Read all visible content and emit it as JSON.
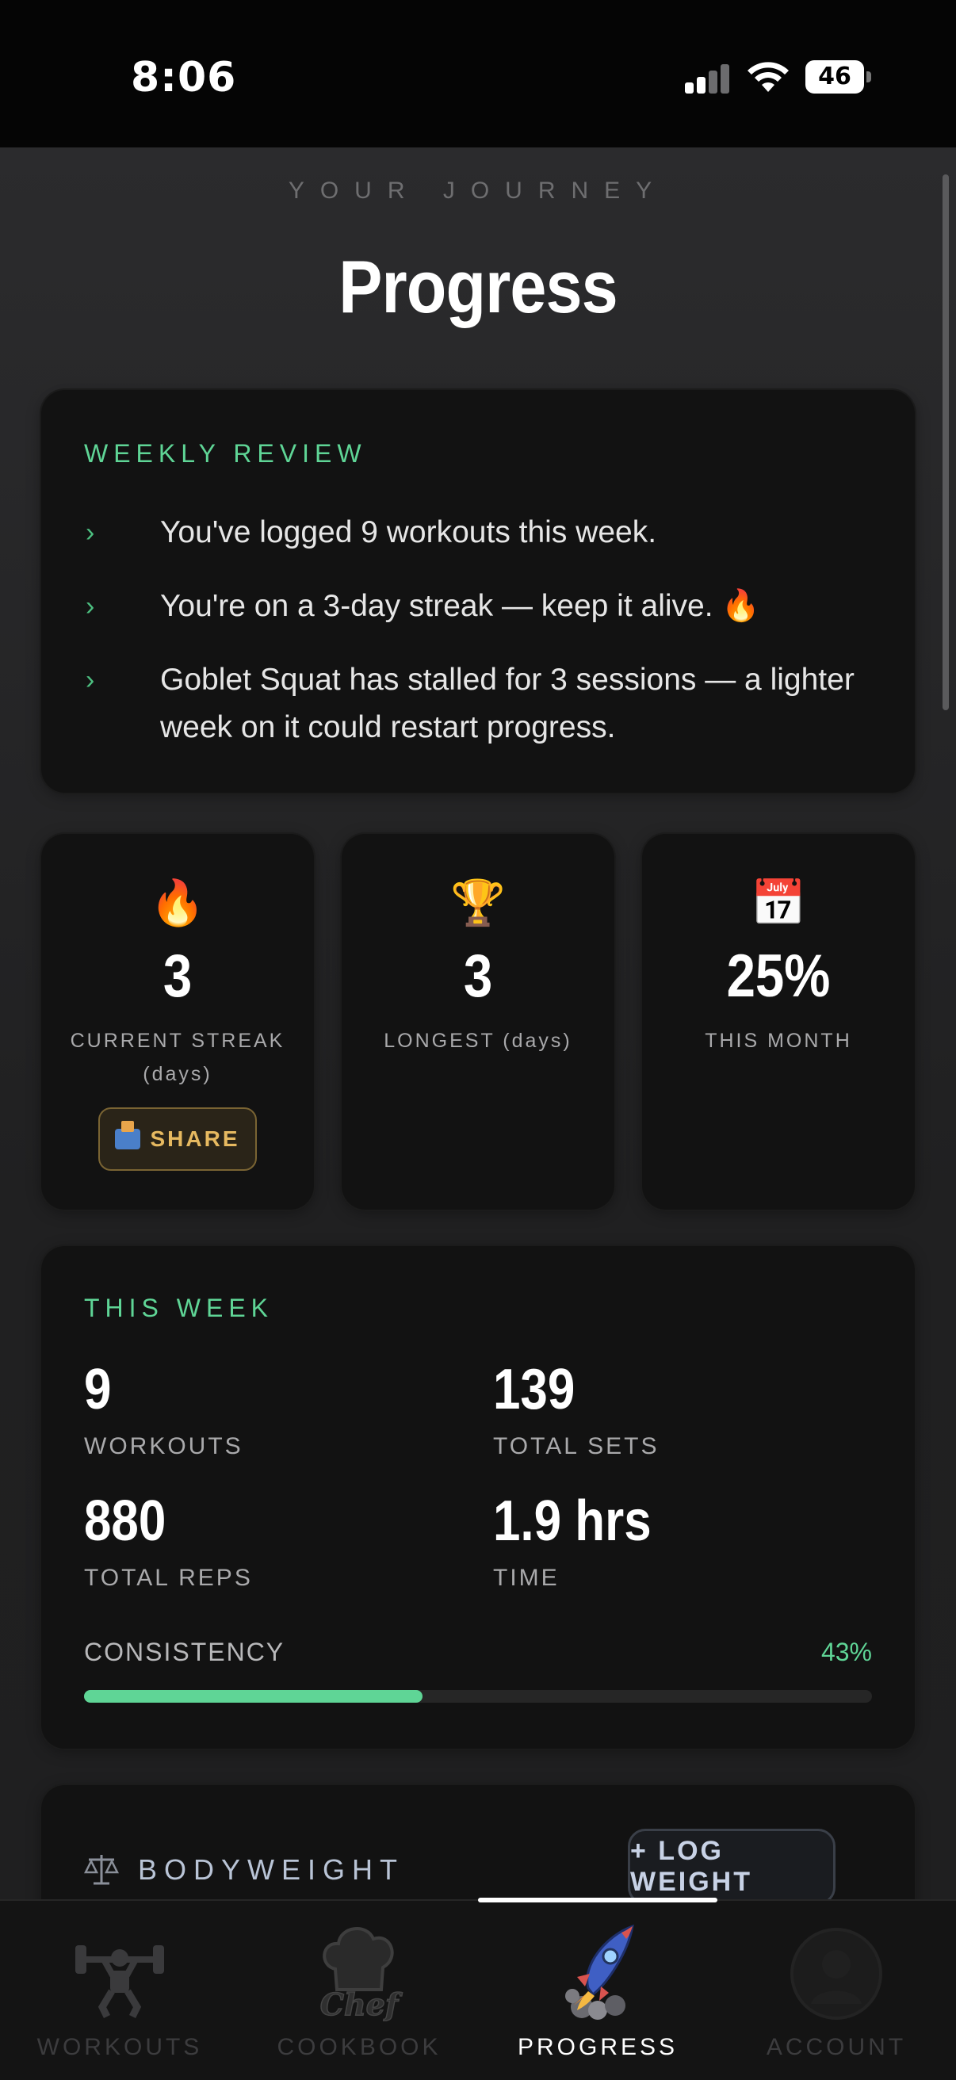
{
  "status_bar": {
    "time": "8:06",
    "battery": "46"
  },
  "header": {
    "eyebrow": "YOUR JOURNEY",
    "title": "Progress"
  },
  "weekly_review": {
    "label": "WEEKLY REVIEW",
    "chevron": "›",
    "items": [
      "You've logged 9 workouts this week.",
      "You're on a 3-day streak — keep it alive. 🔥",
      "Goblet Squat has stalled for 3 sessions — a lighter week on it could restart progress."
    ]
  },
  "stats": [
    {
      "icon": "🔥",
      "icon_name": "fire-icon",
      "value": "3",
      "label": "CURRENT STREAK",
      "sublabel": "(days)"
    },
    {
      "icon": "🏆",
      "icon_name": "trophy-icon",
      "value": "3",
      "label": "LONGEST (days)"
    },
    {
      "icon": "📅",
      "icon_name": "calendar-icon",
      "value": "25%",
      "label": "THIS MONTH"
    }
  ],
  "share_button": {
    "label": "SHARE",
    "icon": "outbox-tray-icon"
  },
  "this_week": {
    "label": "THIS WEEK",
    "metrics": [
      {
        "value": "9",
        "label": "WORKOUTS"
      },
      {
        "value": "139",
        "label": "TOTAL SETS"
      },
      {
        "value": "880",
        "label": "TOTAL REPS"
      },
      {
        "value": "1.9 hrs",
        "label": "TIME"
      }
    ],
    "consistency": {
      "label": "CONSISTENCY",
      "percent_text": "43%",
      "value": 0.43
    }
  },
  "bodyweight": {
    "label": "BODYWEIGHT",
    "icon": "scale-icon",
    "button": "+ LOG WEIGHT"
  },
  "tabbar": {
    "tabs": [
      {
        "label": "WORKOUTS",
        "icon": "weightlifter-icon",
        "active": false
      },
      {
        "label": "COOKBOOK",
        "icon": "chef-hat-icon",
        "active": false
      },
      {
        "label": "PROGRESS",
        "icon": "rocket-icon",
        "active": true
      },
      {
        "label": "ACCOUNT",
        "icon": "avatar-icon",
        "active": false
      }
    ]
  },
  "colors": {
    "accent": "#5fd596",
    "background": "#1e1e1f",
    "card": "#121212",
    "share_gold": "#e6b960"
  }
}
